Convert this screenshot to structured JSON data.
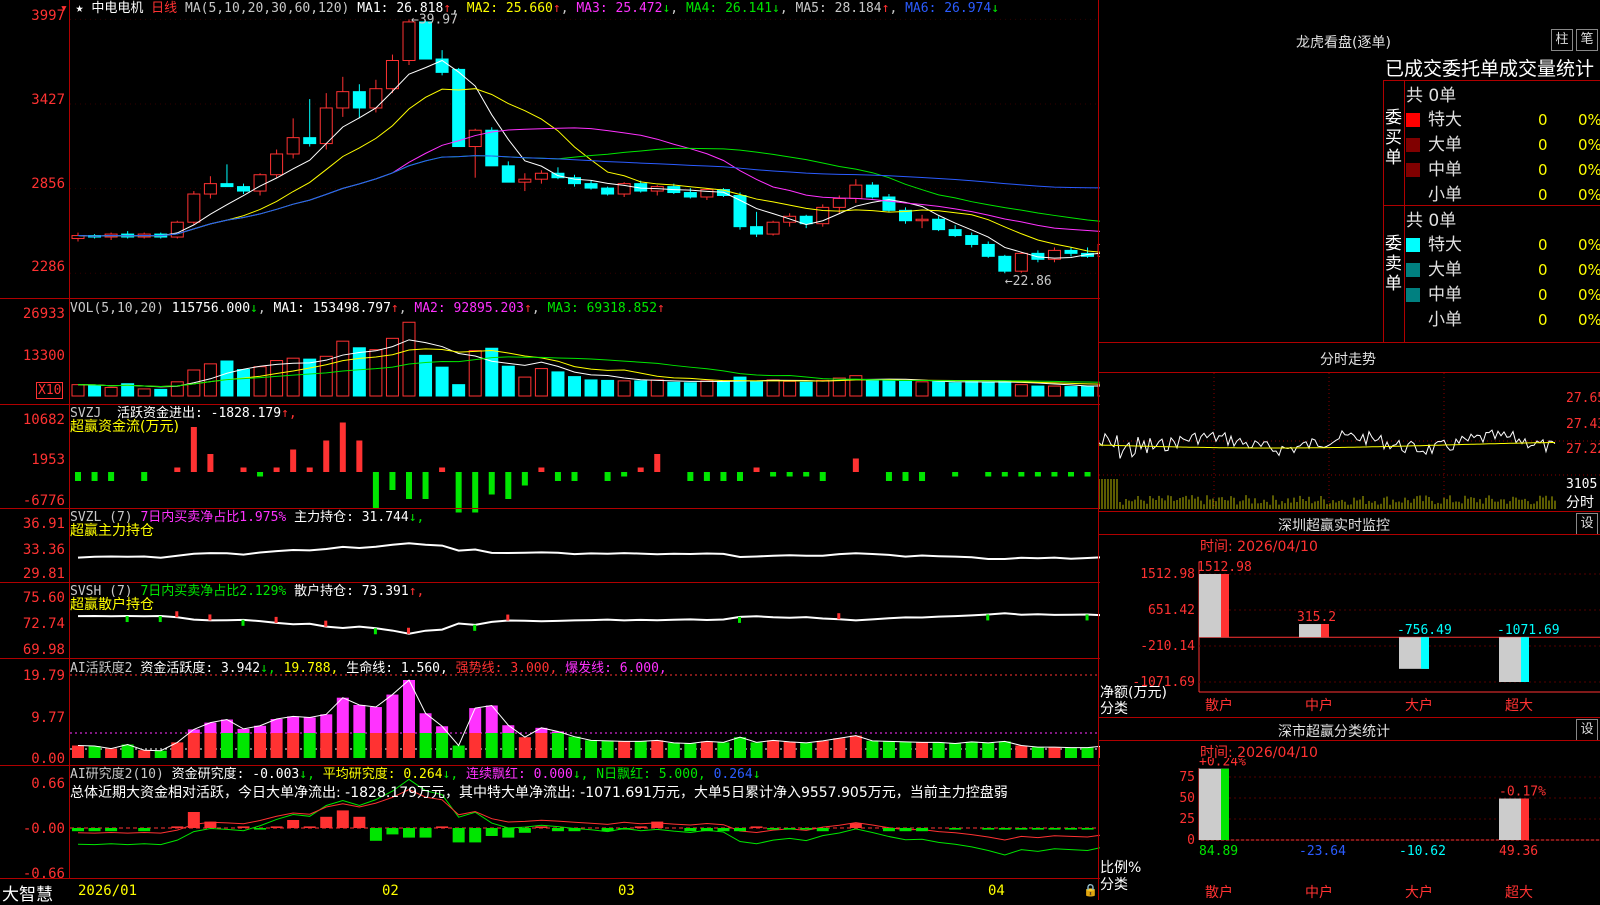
{
  "colors": {
    "up": "#ff3232",
    "down": "#00ffff",
    "grid": "#b00000",
    "ma1": "#ffffff",
    "ma2": "#ffff00",
    "ma3": "#ff32ff",
    "ma4": "#00e600",
    "ma5": "#c8c8c8",
    "ma6": "#2b5cff"
  },
  "main": {
    "star": "★",
    "stock_name": "中电电机",
    "period": "日线",
    "ma_label": "MA(5,10,20,30,60,120)",
    "ma1": "MA1: 26.818",
    "ma1_arrow": "↑",
    "ma2": "MA2: 25.660",
    "ma2_arrow": "↑",
    "ma3": "MA3: 25.472",
    "ma3_arrow": "↓",
    "ma4": "MA4: 26.141",
    "ma4_arrow": "↓",
    "ma5": "MA5: 28.184",
    "ma5_arrow": "↑",
    "ma6": "MA6: 26.974",
    "ma6_arrow": "↓",
    "y_ticks": [
      "3997",
      "3427",
      "2856",
      "2286"
    ],
    "high_mark": "39.97",
    "low_mark": "22.86"
  },
  "vol": {
    "header": "VOL(5,10,20)",
    "value": "115756.000",
    "value_arrow": "↓",
    "ma1": "MA1: 153498.797",
    "ma1_arrow": "↑",
    "ma2": "MA2: 92895.203",
    "ma2_arrow": "↑",
    "ma3": "MA3: 69318.852",
    "ma3_arrow": "↑",
    "y_ticks": [
      "26933",
      "13300"
    ],
    "unit": "X10"
  },
  "svzj": {
    "code": "SVZJ",
    "label": "活跃资金进出: -1828.179",
    "arrow": "↑,",
    "sub": "超赢资金流(万元)",
    "y_ticks": [
      "10682",
      "1953",
      "-6776"
    ]
  },
  "svzl": {
    "code": "SVZL (7)",
    "label1": "7日内买卖净占比1.975%",
    "label2": "主力持仓: 31.744",
    "arrow": "↓,",
    "sub": "超赢主力持仓",
    "y_ticks": [
      "36.91",
      "33.36",
      "29.81"
    ]
  },
  "svsh": {
    "code": "SVSH (7)",
    "label1": "7日内买卖净占比2.129%",
    "label2": "散户持仓: 73.391",
    "arrow": "↑,",
    "sub": "超赢散户持仓",
    "y_ticks": [
      "75.60",
      "72.74",
      "69.98"
    ]
  },
  "ai1": {
    "code": "AI活跃度2",
    "l1": "资金活跃度: 3.942",
    "a1": "↓,",
    "l2": "19.788,",
    "l3": "生命线: 1.560,",
    "l4": "强势线: 3.000,",
    "l5": "爆发线: 6.000,",
    "y_ticks": [
      "19.79",
      "9.77",
      "0.00"
    ]
  },
  "ai2": {
    "code": "AI研究度2(10)",
    "l1": "资金研究度: -0.003",
    "a1": "↓,",
    "l2": "平均研究度: 0.264",
    "a2": "↓,",
    "l3": "连续飘红: 0.000",
    "a3": "↓,",
    "l4": "N日飘红: 5.000,",
    "l5": "0.264",
    "a5": "↓",
    "summary": "总体近期大资金相对活跃，今日大单净流出: -1828.179万元，其中特大单净流出: -1071.691万元，大单5日累计净入9557.905万元，当前主力控盘弱",
    "y_ticks": [
      "0.66",
      "-0.00",
      "-0.66"
    ]
  },
  "xaxis": {
    "brand": "大智慧",
    "labels": [
      "2026/01",
      "02",
      "03",
      "04"
    ]
  },
  "dragon": {
    "title": "龙虎看盘(逐单)",
    "btn1": "柱",
    "btn2": "笔",
    "subtitle": "已成交委托单成交量统计",
    "buy_side": "委买单",
    "sell_side": "委卖单",
    "buy_total": "共 0单",
    "sell_total": "共 0单",
    "rows": [
      {
        "name": "特大",
        "count": "0",
        "pct": "0%"
      },
      {
        "name": "大单",
        "count": "0",
        "pct": "0%"
      },
      {
        "name": "中单",
        "count": "0",
        "pct": "0%"
      },
      {
        "name": "小单",
        "count": "0",
        "pct": "0%"
      }
    ]
  },
  "intraday": {
    "title": "分时走势",
    "y_ticks": [
      "27.65",
      "27.43",
      "27.22"
    ],
    "vol_tick": "3105",
    "footer": "分时"
  },
  "monitor": {
    "title": "深圳超赢实时监控",
    "btn": "设",
    "date": "时间: 2026/04/10",
    "y_ticks": [
      "1512.98",
      "651.42",
      "-210.14",
      "-1071.69"
    ],
    "unit": "净额(万元)",
    "cat_label": "分类",
    "categories": [
      "散户",
      "中户",
      "大户",
      "超大"
    ],
    "values": [
      1512.98,
      315.2,
      -756.49,
      -1071.69
    ],
    "value_labels": [
      "1512.98",
      "315.2",
      "-756.49",
      "-1071.69"
    ]
  },
  "classify": {
    "title": "深市超赢分类统计",
    "btn": "设",
    "date": "时间: 2026/04/10",
    "y_ticks": [
      "75",
      "50",
      "25",
      "0"
    ],
    "unit": "比例%",
    "cat_label": "分类",
    "categories": [
      "散户",
      "中户",
      "大户",
      "超大"
    ],
    "top_labels": [
      "+0.24%",
      "",
      "",
      "-0.17%"
    ],
    "values": [
      84.89,
      -23.64,
      -10.62,
      49.36
    ],
    "value_labels": [
      "84.89",
      "-23.64",
      "-10.62",
      "49.36"
    ]
  },
  "chart_data": {
    "type": "candlestick",
    "title": "中电电机 日线",
    "ohlc": [
      [
        25.2,
        25.6,
        25.0,
        25.4
      ],
      [
        25.4,
        25.5,
        25.2,
        25.3
      ],
      [
        25.3,
        25.6,
        25.1,
        25.5
      ],
      [
        25.5,
        25.7,
        25.2,
        25.3
      ],
      [
        25.3,
        25.6,
        25.2,
        25.5
      ],
      [
        25.5,
        25.6,
        25.2,
        25.3
      ],
      [
        25.3,
        26.4,
        25.2,
        26.3
      ],
      [
        26.3,
        28.4,
        26.1,
        28.2
      ],
      [
        28.2,
        29.4,
        27.9,
        28.9
      ],
      [
        28.9,
        30.2,
        28.7,
        28.7
      ],
      [
        28.7,
        28.9,
        28.2,
        28.4
      ],
      [
        28.4,
        29.6,
        28.1,
        29.5
      ],
      [
        29.5,
        31.2,
        29.3,
        30.9
      ],
      [
        30.9,
        33.3,
        30.6,
        32.0
      ],
      [
        32.0,
        34.6,
        31.4,
        31.6
      ],
      [
        31.6,
        35.0,
        31.2,
        34.0
      ],
      [
        34.0,
        36.1,
        33.4,
        35.1
      ],
      [
        35.1,
        35.6,
        33.3,
        34.0
      ],
      [
        34.0,
        35.9,
        33.7,
        35.3
      ],
      [
        35.3,
        37.6,
        35.0,
        37.2
      ],
      [
        37.2,
        39.97,
        36.9,
        39.8
      ],
      [
        39.8,
        39.9,
        37.3,
        37.3
      ],
      [
        37.3,
        37.9,
        36.2,
        36.4
      ],
      [
        36.6,
        36.7,
        31.4,
        31.4
      ],
      [
        31.4,
        32.6,
        29.3,
        32.5
      ],
      [
        32.5,
        32.7,
        30.1,
        30.1
      ],
      [
        30.1,
        30.4,
        29.0,
        29.0
      ],
      [
        29.0,
        29.6,
        28.4,
        29.2
      ],
      [
        29.2,
        29.8,
        28.9,
        29.6
      ],
      [
        29.6,
        30.0,
        29.2,
        29.3
      ],
      [
        29.3,
        29.5,
        28.7,
        28.9
      ],
      [
        28.9,
        29.1,
        28.5,
        28.6
      ],
      [
        28.6,
        28.7,
        28.1,
        28.2
      ],
      [
        28.2,
        29.0,
        28.0,
        28.9
      ],
      [
        28.9,
        29.1,
        28.3,
        28.4
      ],
      [
        28.4,
        28.8,
        28.1,
        28.7
      ],
      [
        28.7,
        28.9,
        28.2,
        28.3
      ],
      [
        28.3,
        28.6,
        27.9,
        28.0
      ],
      [
        28.0,
        28.6,
        27.8,
        28.5
      ],
      [
        28.5,
        28.6,
        28.0,
        28.1
      ],
      [
        28.1,
        28.3,
        25.8,
        26.0
      ],
      [
        26.0,
        27.0,
        25.3,
        25.5
      ],
      [
        25.5,
        26.4,
        25.4,
        26.3
      ],
      [
        26.3,
        26.9,
        26.0,
        26.7
      ],
      [
        26.7,
        26.8,
        25.9,
        26.2
      ],
      [
        26.2,
        27.5,
        26.0,
        27.3
      ],
      [
        27.3,
        28.1,
        26.9,
        27.9
      ],
      [
        27.9,
        29.2,
        27.6,
        28.8
      ],
      [
        28.8,
        29.0,
        27.9,
        28.0
      ],
      [
        28.0,
        28.2,
        27.0,
        27.1
      ],
      [
        27.1,
        27.3,
        26.2,
        26.4
      ],
      [
        26.4,
        26.8,
        25.9,
        26.5
      ],
      [
        26.5,
        26.7,
        25.7,
        25.8
      ],
      [
        25.8,
        26.1,
        25.3,
        25.4
      ],
      [
        25.4,
        25.6,
        24.6,
        24.8
      ],
      [
        24.8,
        25.0,
        23.9,
        24.0
      ],
      [
        24.0,
        24.1,
        22.86,
        23.0
      ],
      [
        23.0,
        24.3,
        22.9,
        24.2
      ],
      [
        24.2,
        24.4,
        23.6,
        23.8
      ],
      [
        23.8,
        24.6,
        23.6,
        24.4
      ],
      [
        24.4,
        24.6,
        24.0,
        24.2
      ],
      [
        24.2,
        24.6,
        23.9,
        24.0
      ],
      [
        24.0,
        24.9,
        23.8,
        24.8
      ],
      [
        24.8,
        25.0,
        24.2,
        24.3
      ],
      [
        24.3,
        24.6,
        23.9,
        24.2
      ],
      [
        24.2,
        25.9,
        23.7,
        25.8
      ],
      [
        25.8,
        26.1,
        25.2,
        25.5
      ],
      [
        25.5,
        27.6,
        25.2,
        27.4
      ],
      [
        27.4,
        28.1,
        26.1,
        26.5
      ],
      [
        26.5,
        28.4,
        26.2,
        28.2
      ],
      [
        28.2,
        28.3,
        27.4,
        27.6
      ]
    ],
    "volume": [
      2.4,
      2.3,
      1.8,
      2.6,
      1.5,
      1.4,
      3.0,
      5.5,
      6.8,
      7.4,
      5.6,
      6.2,
      7.5,
      8.0,
      7.8,
      8.4,
      11.6,
      10.2,
      9.8,
      12.2,
      15.6,
      8.6,
      6.1,
      2.4,
      9.6,
      10.1,
      6.3,
      4.0,
      5.8,
      5.1,
      4.1,
      3.4,
      3.3,
      3.2,
      3.2,
      3.4,
      2.9,
      2.8,
      3.2,
      3.0,
      4.0,
      3.0,
      3.4,
      3.1,
      2.9,
      3.3,
      3.8,
      4.3,
      3.3,
      3.2,
      3.1,
      3.0,
      3.0,
      2.8,
      3.1,
      2.9,
      3.2,
      2.4,
      2.1,
      2.1,
      2.0,
      2.0,
      2.3,
      2.1,
      2.4,
      5.5,
      8.9,
      11.8,
      13.2,
      8.7,
      5.0
    ],
    "svzj": [
      -2,
      -2,
      -2,
      0,
      -2,
      0,
      1,
      10,
      4,
      0,
      1,
      -1,
      1,
      5,
      1,
      7,
      11,
      7,
      -8,
      -4,
      -6,
      -6,
      1,
      -9,
      -9,
      -5,
      -6,
      -3,
      1,
      -2,
      -2,
      0,
      -2,
      -1,
      1,
      4,
      0,
      -2,
      -2,
      -2,
      -2,
      1,
      -1,
      -1,
      -1,
      -2,
      0,
      3,
      0,
      -2,
      -2,
      -2,
      0,
      -1,
      0,
      -1,
      -1,
      -1,
      -1,
      -1,
      -1,
      -1,
      0,
      0,
      -1,
      -1,
      2,
      11,
      1,
      -1,
      -3
    ]
  }
}
